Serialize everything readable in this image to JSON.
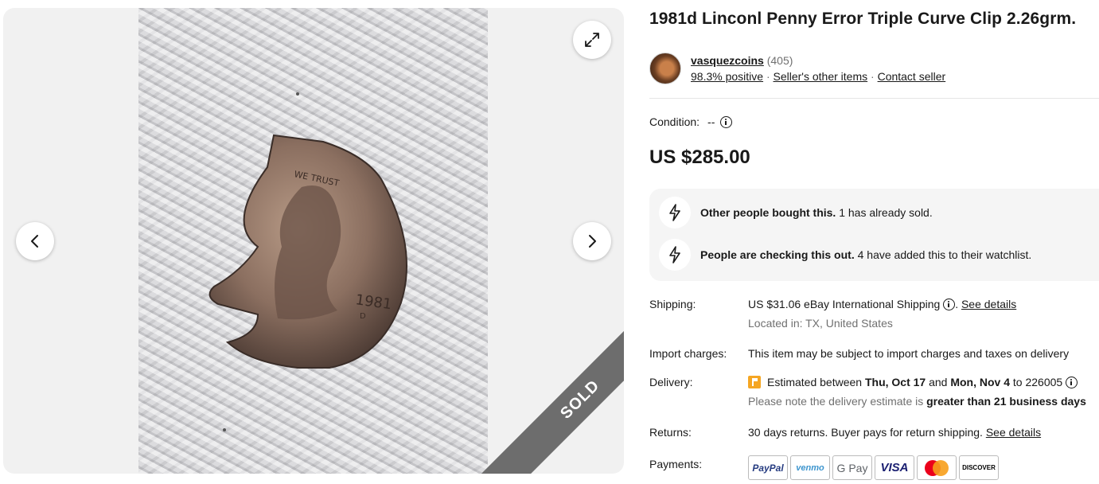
{
  "listing": {
    "title": "1981d Linconl Penny Error Triple Curve Clip 2.26grm.",
    "sold_label": "SOLD"
  },
  "seller": {
    "name": "vasquezcoins",
    "rating_count": "(405)",
    "positive": "98.3% positive",
    "sep": "·",
    "other_items": "Seller's other items",
    "contact": "Contact seller"
  },
  "condition": {
    "label": "Condition:",
    "value": "--"
  },
  "price": "US $285.00",
  "signals": [
    {
      "bold": "Other people bought this.",
      "text": " 1 has already sold."
    },
    {
      "bold": "People are checking this out.",
      "text": " 4 have added this to their watchlist."
    }
  ],
  "shipping": {
    "label": "Shipping:",
    "cost": "US $31.06",
    "method": " eBay International Shipping ",
    "dot": ". ",
    "see_details": "See details",
    "location": "Located in: TX, United States"
  },
  "import": {
    "label": "Import charges:",
    "text": "This item may be subject to import charges and taxes on delivery"
  },
  "delivery": {
    "label": "Delivery:",
    "est_prefix": "Estimated between ",
    "date1": "Thu, Oct 17",
    "and": " and ",
    "date2": "Mon, Nov 4",
    "to": " to 226005 ",
    "note_prefix": "Please note the delivery estimate is ",
    "note_bold": "greater than 21 business days"
  },
  "returns": {
    "label": "Returns:",
    "text": "30 days returns. Buyer pays for return shipping. ",
    "see_details": "See details"
  },
  "payments": {
    "label": "Payments:",
    "methods": [
      "PayPal",
      "venmo",
      "G Pay",
      "VISA",
      "Mastercard",
      "DISCOVER"
    ]
  },
  "colors": {
    "accent": "#f5a623",
    "ribbon": "#6d6d6d",
    "signal_bg": "#f5f5f5"
  }
}
